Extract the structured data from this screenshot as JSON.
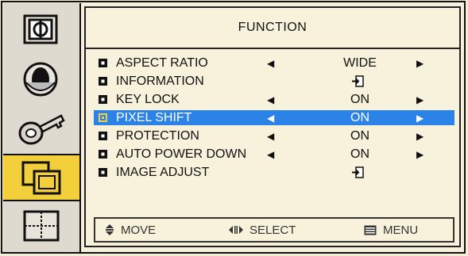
{
  "sidebar": {
    "items": [
      {
        "icon": "picture-icon",
        "active": false
      },
      {
        "icon": "speaker-icon",
        "active": false
      },
      {
        "icon": "key-icon",
        "active": false
      },
      {
        "icon": "function-icon",
        "active": true
      },
      {
        "icon": "window-icon",
        "active": false
      }
    ]
  },
  "panel": {
    "title": "FUNCTION",
    "rows": [
      {
        "label": "ASPECT RATIO",
        "left": "◀",
        "value": "WIDE",
        "right": "▶",
        "type": "value"
      },
      {
        "label": "INFORMATION",
        "type": "enter"
      },
      {
        "label": "KEY LOCK",
        "left": "◀",
        "value": "ON",
        "right": "▶",
        "type": "value"
      },
      {
        "label": "PIXEL SHIFT",
        "left": "◀",
        "value": "ON",
        "right": "▶",
        "type": "value",
        "selected": true
      },
      {
        "label": "PROTECTION",
        "left": "◀",
        "value": "ON",
        "right": "▶",
        "type": "value"
      },
      {
        "label": "AUTO POWER DOWN",
        "left": "◀",
        "value": "ON",
        "right": "▶",
        "type": "value"
      },
      {
        "label": "IMAGE ADJUST",
        "type": "enter"
      }
    ]
  },
  "footer": {
    "move": "MOVE",
    "select": "SELECT",
    "menu": "MENU"
  },
  "colors": {
    "highlight": "#2b83e8",
    "active_tab": "#f2cf3b",
    "background": "#f8f2dd"
  }
}
